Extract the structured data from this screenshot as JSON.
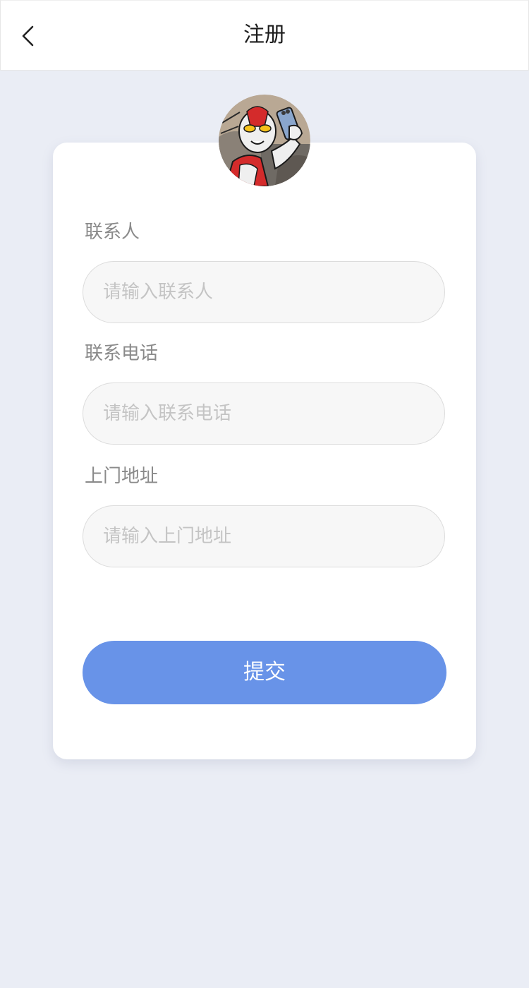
{
  "header": {
    "title": "注册",
    "back_icon": "chevron-left-icon"
  },
  "avatar": {
    "description_icon": "avatar-image"
  },
  "form": {
    "contact": {
      "label": "联系人",
      "placeholder": "请输入联系人",
      "value": ""
    },
    "phone": {
      "label": "联系电话",
      "placeholder": "请输入联系电话",
      "value": ""
    },
    "address": {
      "label": "上门地址",
      "placeholder": "请输入上门地址",
      "value": ""
    },
    "submit_label": "提交"
  },
  "colors": {
    "background": "#eaedf5",
    "primary": "#6893e8",
    "card": "#ffffff"
  }
}
